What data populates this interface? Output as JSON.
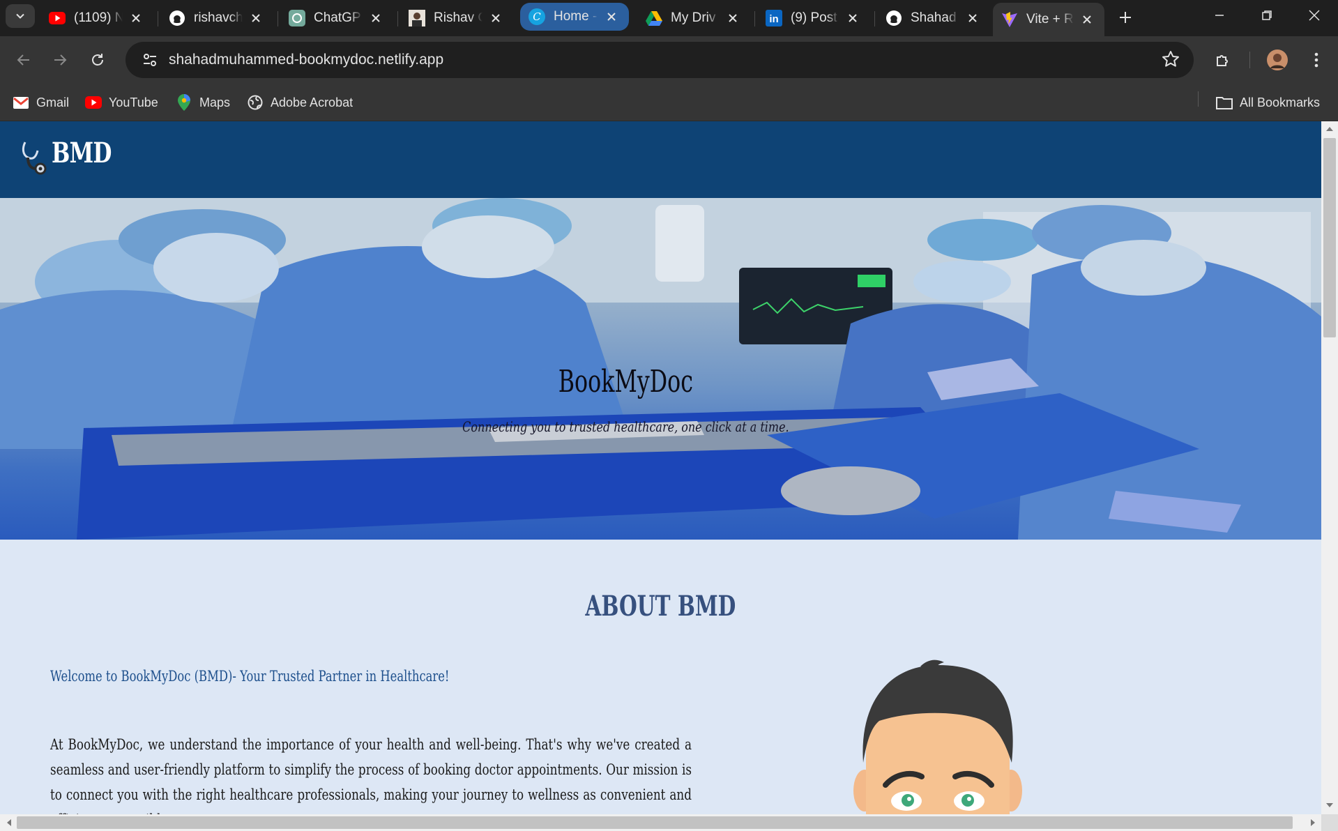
{
  "tabs": [
    {
      "label": "(1109) N",
      "icon": "youtube-icon"
    },
    {
      "label": "rishavch",
      "icon": "github-icon"
    },
    {
      "label": "ChatGP",
      "icon": "chatgpt-icon"
    },
    {
      "label": "Rishav C",
      "icon": "profile-photo-icon"
    },
    {
      "label": "Home -",
      "icon": "canva-icon"
    },
    {
      "label": "My Driv",
      "icon": "google-drive-icon"
    },
    {
      "label": "(9) Post",
      "icon": "linkedin-icon"
    },
    {
      "label": "Shahad",
      "icon": "github-icon"
    },
    {
      "label": "Vite + R",
      "icon": "vite-icon"
    }
  ],
  "address": {
    "url": "shahadmuhammed-bookmydoc.netlify.app"
  },
  "bookmarks": [
    {
      "label": "Gmail",
      "icon": "gmail-icon"
    },
    {
      "label": "YouTube",
      "icon": "youtube-icon"
    },
    {
      "label": "Maps",
      "icon": "maps-icon"
    },
    {
      "label": "Adobe Acrobat",
      "icon": "globe-icon"
    }
  ],
  "all_bookmarks": "All Bookmarks",
  "site": {
    "brand": "BMD",
    "hero_title": "BookMyDoc",
    "hero_subtitle": "Connecting you to trusted healthcare, one click at a time.",
    "about_title": "ABOUT BMD",
    "about_welcome": "Welcome to BookMyDoc (BMD)- Your Trusted Partner in Healthcare!",
    "about_body": "At BookMyDoc, we understand the importance of your health and well-being. That's why we've created a seamless and user-friendly platform to simplify the process of booking doctor appointments. Our mission is to connect you with the right healthcare professionals, making your journey to wellness as convenient and efficient as possible."
  },
  "colors": {
    "site_nav": "#0e4375",
    "page_bg": "#dde7f5",
    "about_title": "#36507e",
    "welcome_text": "#1d4f8c",
    "active_tab": "#353535",
    "highlighted_tab": "#2b5f9e"
  }
}
